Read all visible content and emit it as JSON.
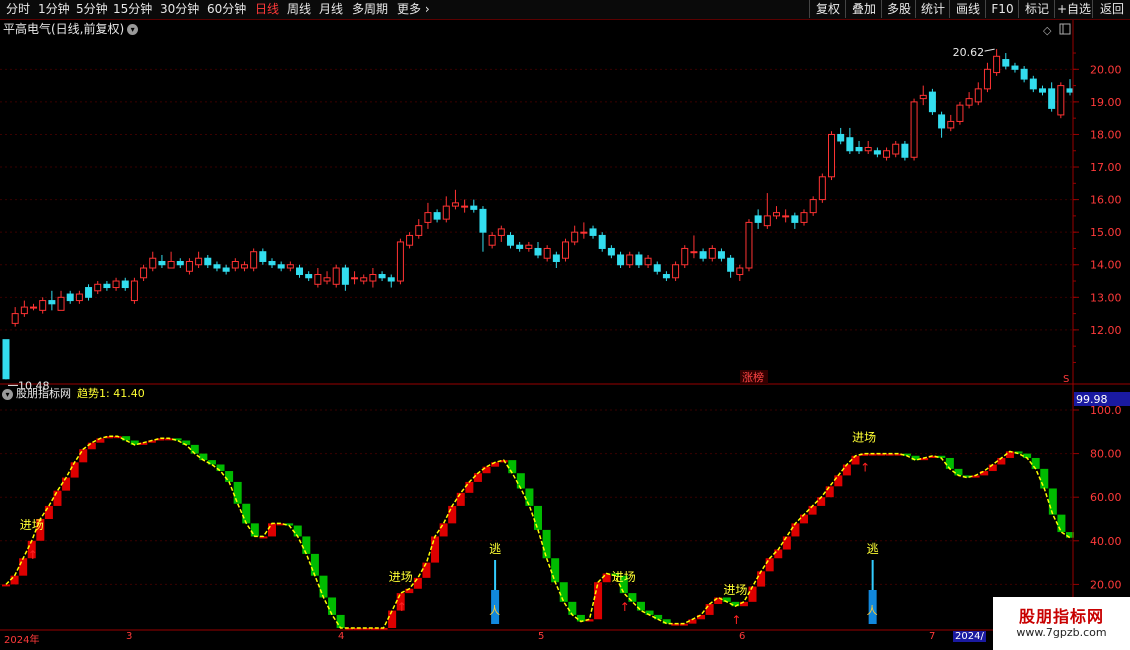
{
  "toolbar": {
    "periods": [
      "分时",
      "1分钟",
      "5分钟",
      "15分钟",
      "30分钟",
      "60分钟",
      "日线",
      "周线",
      "月线",
      "多周期",
      "更多"
    ],
    "active_period": "日线",
    "buttons": [
      "复权",
      "叠加",
      "多股",
      "统计",
      "画线",
      "F10",
      "标记",
      "+自选",
      "返回"
    ]
  },
  "main_chart": {
    "title": "平高电气(日线,前复权)",
    "high_label": "20.62",
    "low_label": "10.48",
    "zhangting_label": "涨榜",
    "y_ticks": [
      "20.00",
      "19.00",
      "18.00",
      "17.00",
      "16.00",
      "15.00",
      "14.00",
      "13.00",
      "12.00"
    ]
  },
  "indicator": {
    "name": "股朋指标网",
    "value_label": "趋势1: 41.40",
    "top_value": "99.98",
    "y_ticks": [
      "100.0",
      "80.00",
      "60.00",
      "40.00",
      "20.00"
    ],
    "signals": {
      "entry": "进场",
      "escape": "逃"
    }
  },
  "dates": [
    "2024年",
    "3",
    "4",
    "5",
    "6",
    "7",
    "2024/"
  ],
  "watermark": {
    "line1": "股朋指标网",
    "line2": "www.7gpzb.com"
  },
  "colors": {
    "up": "#ff3333",
    "down": "#33ddee",
    "bar_red": "#dd0000",
    "bar_green": "#00bb00",
    "trend_line": "#ffff00",
    "axis": "#990000"
  },
  "chart_data": {
    "type": "candlestick",
    "title": "平高电气(日线,前复权)",
    "price_ylim": [
      10.4,
      20.9
    ],
    "candles": [
      [
        11.7,
        10.5,
        11.7,
        10.48
      ],
      [
        12.2,
        12.5,
        12.7,
        12.1
      ],
      [
        12.5,
        12.7,
        12.9,
        12.4
      ],
      [
        12.7,
        12.7,
        12.8,
        12.6
      ],
      [
        12.6,
        12.9,
        13.0,
        12.5
      ],
      [
        12.9,
        12.8,
        13.2,
        12.6
      ],
      [
        12.6,
        13.0,
        13.2,
        12.6
      ],
      [
        13.1,
        12.9,
        13.2,
        12.8
      ],
      [
        12.9,
        13.1,
        13.2,
        12.8
      ],
      [
        13.3,
        13.0,
        13.4,
        12.9
      ],
      [
        13.2,
        13.4,
        13.5,
        13.1
      ],
      [
        13.4,
        13.3,
        13.5,
        13.2
      ],
      [
        13.3,
        13.5,
        13.6,
        13.2
      ],
      [
        13.5,
        13.3,
        13.6,
        13.2
      ],
      [
        12.9,
        13.5,
        13.6,
        12.8
      ],
      [
        13.6,
        13.9,
        14.0,
        13.5
      ],
      [
        13.9,
        14.2,
        14.4,
        13.8
      ],
      [
        14.1,
        14.0,
        14.3,
        13.9
      ],
      [
        13.9,
        14.1,
        14.4,
        13.9
      ],
      [
        14.1,
        14.0,
        14.2,
        13.9
      ],
      [
        13.8,
        14.1,
        14.2,
        13.7
      ],
      [
        14.0,
        14.2,
        14.4,
        13.9
      ],
      [
        14.2,
        14.0,
        14.3,
        13.9
      ],
      [
        14.0,
        13.9,
        14.1,
        13.8
      ],
      [
        13.9,
        13.8,
        14.0,
        13.7
      ],
      [
        13.9,
        14.1,
        14.2,
        13.8
      ],
      [
        13.9,
        14.0,
        14.1,
        13.8
      ],
      [
        13.9,
        14.4,
        14.5,
        13.8
      ],
      [
        14.4,
        14.1,
        14.5,
        14.0
      ],
      [
        14.1,
        14.0,
        14.2,
        13.9
      ],
      [
        14.0,
        13.9,
        14.1,
        13.8
      ],
      [
        13.9,
        14.0,
        14.1,
        13.8
      ],
      [
        13.9,
        13.7,
        14.0,
        13.6
      ],
      [
        13.7,
        13.6,
        13.8,
        13.5
      ],
      [
        13.4,
        13.7,
        13.9,
        13.3
      ],
      [
        13.5,
        13.6,
        13.8,
        13.4
      ],
      [
        13.4,
        13.9,
        14.0,
        13.3
      ],
      [
        13.9,
        13.4,
        14.0,
        13.2
      ],
      [
        13.6,
        13.6,
        13.8,
        13.4
      ],
      [
        13.5,
        13.6,
        13.7,
        13.4
      ],
      [
        13.5,
        13.7,
        13.9,
        13.3
      ],
      [
        13.7,
        13.6,
        13.8,
        13.5
      ],
      [
        13.6,
        13.5,
        13.7,
        13.3
      ],
      [
        13.5,
        14.7,
        14.8,
        13.4
      ],
      [
        14.6,
        14.9,
        15.0,
        14.5
      ],
      [
        14.9,
        15.2,
        15.4,
        14.8
      ],
      [
        15.3,
        15.6,
        15.9,
        15.1
      ],
      [
        15.6,
        15.4,
        15.7,
        15.3
      ],
      [
        15.4,
        15.8,
        16.1,
        15.3
      ],
      [
        15.8,
        15.9,
        16.3,
        15.7
      ],
      [
        15.8,
        15.8,
        16.0,
        15.6
      ],
      [
        15.8,
        15.7,
        16.0,
        15.6
      ],
      [
        15.7,
        15.0,
        15.8,
        14.4
      ],
      [
        14.6,
        14.9,
        15.0,
        14.5
      ],
      [
        14.9,
        15.1,
        15.2,
        14.7
      ],
      [
        14.9,
        14.6,
        15.0,
        14.5
      ],
      [
        14.6,
        14.5,
        14.7,
        14.4
      ],
      [
        14.5,
        14.6,
        14.7,
        14.4
      ],
      [
        14.5,
        14.3,
        14.7,
        14.2
      ],
      [
        14.2,
        14.5,
        14.6,
        14.1
      ],
      [
        14.3,
        14.1,
        14.4,
        13.9
      ],
      [
        14.2,
        14.7,
        14.8,
        14.1
      ],
      [
        14.7,
        15.0,
        15.2,
        14.6
      ],
      [
        15.0,
        15.0,
        15.3,
        14.8
      ],
      [
        15.1,
        14.9,
        15.2,
        14.8
      ],
      [
        14.9,
        14.5,
        15.0,
        14.4
      ],
      [
        14.5,
        14.3,
        14.6,
        14.2
      ],
      [
        14.3,
        14.0,
        14.4,
        13.9
      ],
      [
        14.0,
        14.3,
        14.4,
        13.9
      ],
      [
        14.3,
        14.0,
        14.4,
        13.9
      ],
      [
        14.0,
        14.2,
        14.3,
        13.9
      ],
      [
        14.0,
        13.8,
        14.1,
        13.7
      ],
      [
        13.7,
        13.6,
        13.8,
        13.5
      ],
      [
        13.6,
        14.0,
        14.1,
        13.5
      ],
      [
        14.0,
        14.5,
        14.6,
        13.9
      ],
      [
        14.4,
        14.4,
        14.9,
        14.2
      ],
      [
        14.4,
        14.2,
        14.5,
        14.1
      ],
      [
        14.2,
        14.5,
        14.6,
        14.1
      ],
      [
        14.4,
        14.2,
        14.5,
        14.1
      ],
      [
        14.2,
        13.8,
        14.3,
        13.6
      ],
      [
        13.7,
        13.9,
        14.0,
        13.5
      ],
      [
        13.9,
        15.3,
        15.4,
        13.8
      ],
      [
        15.5,
        15.3,
        15.7,
        15.1
      ],
      [
        15.2,
        15.5,
        16.2,
        15.1
      ],
      [
        15.5,
        15.6,
        15.8,
        15.4
      ],
      [
        15.5,
        15.5,
        15.7,
        15.3
      ],
      [
        15.5,
        15.3,
        15.6,
        15.1
      ],
      [
        15.3,
        15.6,
        15.7,
        15.2
      ],
      [
        15.6,
        16.0,
        16.1,
        15.5
      ],
      [
        16.0,
        16.7,
        16.8,
        15.9
      ],
      [
        16.7,
        18.0,
        18.1,
        16.6
      ],
      [
        18.0,
        17.8,
        18.2,
        17.7
      ],
      [
        17.9,
        17.5,
        18.2,
        17.4
      ],
      [
        17.6,
        17.5,
        17.8,
        17.4
      ],
      [
        17.5,
        17.6,
        17.8,
        17.4
      ],
      [
        17.5,
        17.4,
        17.6,
        17.3
      ],
      [
        17.3,
        17.5,
        17.6,
        17.2
      ],
      [
        17.4,
        17.7,
        17.8,
        17.3
      ],
      [
        17.7,
        17.3,
        17.8,
        17.2
      ],
      [
        17.3,
        19.0,
        19.1,
        17.2
      ],
      [
        19.1,
        19.2,
        19.5,
        18.9
      ],
      [
        19.3,
        18.7,
        19.4,
        18.6
      ],
      [
        18.6,
        18.2,
        18.7,
        17.9
      ],
      [
        18.2,
        18.4,
        18.6,
        18.1
      ],
      [
        18.4,
        18.9,
        19.0,
        18.3
      ],
      [
        18.9,
        19.1,
        19.3,
        18.8
      ],
      [
        19.0,
        19.4,
        19.6,
        18.9
      ],
      [
        19.4,
        20.0,
        20.2,
        19.3
      ],
      [
        19.9,
        20.4,
        20.62,
        19.8
      ],
      [
        20.3,
        20.1,
        20.5,
        20.0
      ],
      [
        20.1,
        20.0,
        20.2,
        19.9
      ],
      [
        20.0,
        19.7,
        20.1,
        19.6
      ],
      [
        19.7,
        19.4,
        19.8,
        19.3
      ],
      [
        19.4,
        19.3,
        19.5,
        19.2
      ],
      [
        19.4,
        18.8,
        19.6,
        18.7
      ],
      [
        18.6,
        19.5,
        19.6,
        18.5
      ],
      [
        19.4,
        19.3,
        19.7,
        19.2
      ]
    ],
    "indicator_series": {
      "name": "趋势1",
      "ylim": [
        0,
        100
      ],
      "values": [
        20,
        24,
        32,
        40,
        50,
        56,
        63,
        69,
        76,
        82,
        85,
        87,
        88,
        88,
        86,
        84,
        85,
        86,
        87,
        87,
        86,
        84,
        80,
        77,
        75,
        72,
        67,
        57,
        48,
        42,
        42,
        48,
        48,
        47,
        42,
        34,
        24,
        14,
        6,
        0,
        0,
        0,
        0,
        0,
        0,
        8,
        16,
        18,
        23,
        30,
        42,
        48,
        56,
        62,
        67,
        71,
        74,
        76,
        77,
        71,
        64,
        56,
        45,
        32,
        21,
        12,
        6,
        3,
        4,
        21,
        25,
        24,
        16,
        12,
        8,
        6,
        4,
        2,
        2,
        2,
        4,
        6,
        11,
        14,
        12,
        10,
        12,
        19,
        26,
        32,
        36,
        42,
        48,
        52,
        56,
        60,
        65,
        70,
        75,
        79,
        80,
        80,
        80,
        80,
        80,
        79,
        77,
        78,
        79,
        78,
        73,
        70,
        69,
        70,
        72,
        75,
        78,
        81,
        80,
        78,
        73,
        64,
        52,
        44,
        41.4
      ],
      "entry_bar_indices": [
        3,
        46,
        72,
        85,
        100
      ],
      "escape_bar_indices": [
        57,
        101
      ]
    }
  }
}
